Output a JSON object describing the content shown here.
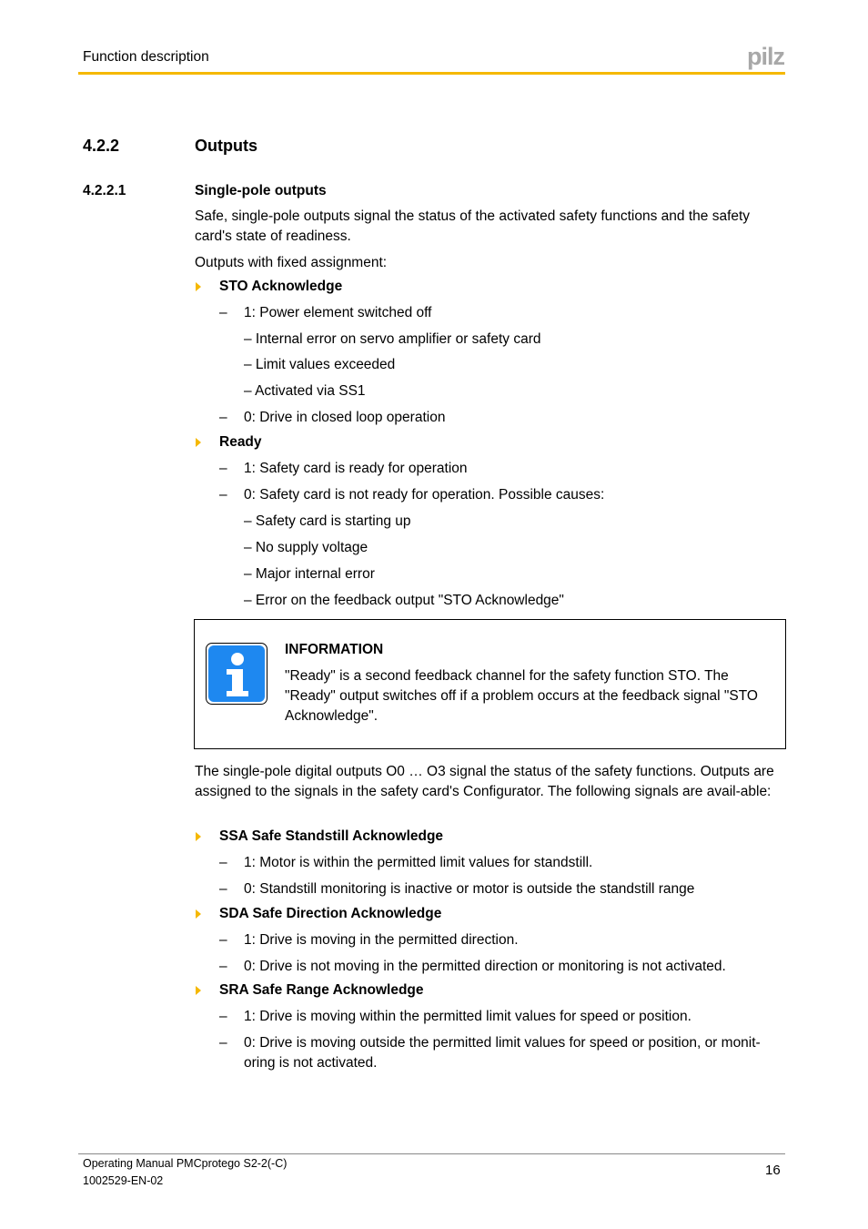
{
  "header": {
    "section": "Function description",
    "logo": "pilz",
    "accent": "#f5b800"
  },
  "heading": {
    "number": "4.2.2",
    "title": "Outputs"
  },
  "subheading": {
    "number": "4.2.2.1",
    "title": "Single-pole outputs"
  },
  "intro": "Safe, single-pole outputs signal the status of the activated safety functions and the safety card's state of readiness.",
  "fixed_label": "Outputs with fixed assignment:",
  "sto": {
    "title": "STO Acknowledge",
    "l1": "1: Power element switched off",
    "s1": "– Internal error on servo amplifier or safety card",
    "s2": "– Limit values exceeded",
    "s3": "– Activated via SS1",
    "l0": "0: Drive in closed loop operation"
  },
  "ready": {
    "title": "Ready",
    "l1": "1: Safety card is ready for operation",
    "l0": "0: Safety card is not ready for operation. Possible causes:",
    "s1": "– Safety card is starting up",
    "s2": "– No supply voltage",
    "s3": "– Major internal error",
    "s4": "– Error on the feedback output \"STO Acknowledge\""
  },
  "info": {
    "title": "INFORMATION",
    "text": "\"Ready\" is a second feedback channel for the safety function STO. The \"Ready\" output switches off if a problem occurs at the feedback signal \"STO Acknowledge\".",
    "icon": "info-icon",
    "icon_color": "#1e88f0"
  },
  "outputs_para": "The single-pole digital outputs O0 … O3 signal the status of the safety functions. Outputs are assigned to the signals in the safety card's Configurator. The following signals are avail-able:",
  "ssa": {
    "title": "SSA Safe Standstill Acknowledge",
    "l1": "1: Motor is within the permitted limit values for standstill.",
    "l0": "0: Standstill monitoring is inactive or motor is outside the standstill range"
  },
  "sda": {
    "title": "SDA Safe Direction Acknowledge",
    "l1": "1: Drive is moving in the permitted direction.",
    "l0": "0: Drive is not moving in the permitted direction or monitoring is not activated."
  },
  "sra": {
    "title": "SRA Safe Range Acknowledge",
    "l1": "1: Drive is moving within the permitted limit values for speed or position.",
    "l0": "0: Drive is moving outside the permitted limit values for speed or position, or monit-oring is not activated."
  },
  "dash": "–",
  "footer": {
    "manual": "Operating Manual PMCprotego S2-2(-C)",
    "doc": "1002529-EN-02",
    "page": "16"
  }
}
